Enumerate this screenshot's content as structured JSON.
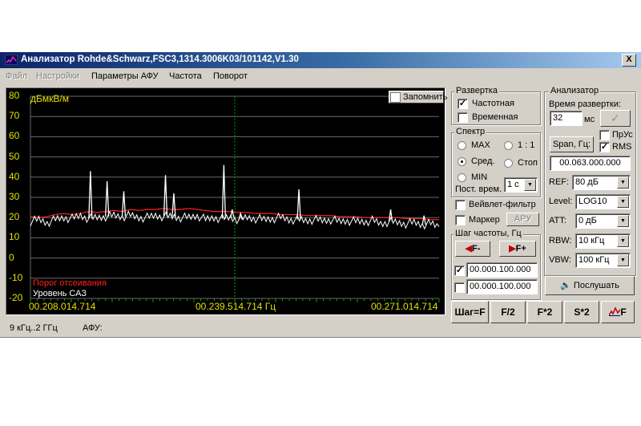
{
  "window": {
    "title": "Анализатор Rohde&Schwarz,FSC3,1314.3006K03/101142,V1.30",
    "close_glyph": "X"
  },
  "menu": [
    {
      "label": "Файл",
      "enabled": false
    },
    {
      "label": "Настройки",
      "enabled": false
    },
    {
      "label": "Параметры АФУ",
      "enabled": true
    },
    {
      "label": "Частота",
      "enabled": true
    },
    {
      "label": "Поворот",
      "enabled": true
    }
  ],
  "plot": {
    "memory_label": "Запомнить",
    "memory_checked": false,
    "threshold_label": "Порог отсеивания",
    "level_label": "Уровень САЗ",
    "colors": {
      "background": "#000000",
      "grid": "#6a6a6a",
      "threshold": "#ff2020",
      "trace": "#ffffff",
      "axis_text": "#e0e000",
      "marker": "#00a000"
    }
  },
  "chart_data": {
    "type": "line",
    "ylabel": "дБмкВ/м",
    "ylim": [
      -20,
      80
    ],
    "y_ticks": [
      "80",
      "70",
      "60",
      "50",
      "40",
      "30",
      "20",
      "10",
      "0",
      "-10",
      "-20"
    ],
    "x_tick_labels": [
      "00.208.014.714",
      "00.239.514.714 Гц",
      "00.271.014.714"
    ],
    "grid": true,
    "series": [
      {
        "name": "Порог отсеивания",
        "color": "#ff2020",
        "values": [
          20.5,
          20,
          20.5,
          21.5,
          22,
          21.5,
          22,
          23,
          22.5,
          23,
          23.5,
          23,
          24,
          23.5,
          24,
          24,
          24.5,
          24,
          24,
          24.5,
          24,
          23.5,
          23,
          23,
          23,
          22.5,
          22.5,
          22,
          22,
          22,
          21.5,
          21.5,
          21.5,
          21,
          21,
          21,
          21,
          20.5,
          20.5,
          20.5,
          20,
          20,
          20,
          20,
          20,
          19.5,
          19.5,
          19.5,
          19,
          19
        ]
      },
      {
        "name": "Уровень САЗ",
        "color": "#ffffff",
        "values": [
          18,
          19,
          17.5,
          19,
          20,
          19.5,
          21,
          19.5,
          20,
          20.5,
          21,
          20.5,
          21,
          20,
          20,
          21,
          20.5,
          20.5,
          20,
          20,
          21,
          19,
          20,
          19.5,
          20,
          19,
          20,
          19.5,
          19,
          19.5,
          20,
          19,
          19,
          18.5,
          19,
          18.5,
          19,
          18,
          18.5,
          18,
          18,
          18.5,
          17,
          18,
          17.5,
          17,
          17.5,
          16.5,
          17,
          15.5
        ],
        "peaks": [
          {
            "i": 7,
            "v": 43
          },
          {
            "i": 9,
            "v": 38
          },
          {
            "i": 11,
            "v": 33
          },
          {
            "i": 16,
            "v": 41
          },
          {
            "i": 17,
            "v": 32
          },
          {
            "i": 23,
            "v": 46
          },
          {
            "i": 24,
            "v": 24
          },
          {
            "i": 25,
            "v": 22
          },
          {
            "i": 32,
            "v": 34
          },
          {
            "i": 43,
            "v": 24
          },
          {
            "i": 47,
            "v": 21
          }
        ]
      }
    ],
    "center_marker_index": 24.5
  },
  "panel": {
    "sweep": {
      "title": "Развертка",
      "freq_label": "Частотная",
      "freq_checked": true,
      "time_label": "Временная",
      "time_checked": false
    },
    "spectrum": {
      "title": "Спектр",
      "max_label": "MAX",
      "one_label": "1 : 1",
      "avg_label": "Сред.",
      "stop_label": "Стоп",
      "min_label": "MIN",
      "selected": "avg",
      "const_label": "Пост. врем.",
      "const_value": "1 с"
    },
    "wavelet_label": "Вейвлет-фильтр",
    "wavelet_checked": false,
    "marker_label": "Маркер",
    "marker_checked": false,
    "apu_label": "АРУ",
    "step": {
      "title": "Шаг частоты, Гц",
      "minus_label": "F-",
      "plus_label": "F+",
      "row1_checked": true,
      "row1_value": "00.000.100.000",
      "row2_checked": false,
      "row2_value": "00.000.100.000"
    },
    "analyzer": {
      "title": "Анализатор",
      "sweep_time_label": "Время развертки:",
      "sweep_time_value": "32",
      "ms_label": "мс",
      "prus_label": "ПрУс",
      "prus_checked": false,
      "span_label": "Span, Гц:",
      "rms_label": "RMS",
      "rms_checked": true,
      "span_value": "00.063.000.000",
      "ref_label": "REF:",
      "ref_value": "80 дБ",
      "level_label": "Level:",
      "level_value": "LOG10",
      "att_label": "ATT:",
      "att_value": "0 дБ",
      "rbw_label": "RBW:",
      "rbw_value": "10 кГц",
      "vbw_label": "VBW:",
      "vbw_value": "100 кГц"
    },
    "listen_label": "Послушать",
    "bottom_buttons": [
      "Шаг=F",
      "F/2",
      "F*2",
      "S*2",
      "F"
    ]
  },
  "status": {
    "range": "9 кГц..2 ГГц",
    "afu": "АФУ:"
  }
}
